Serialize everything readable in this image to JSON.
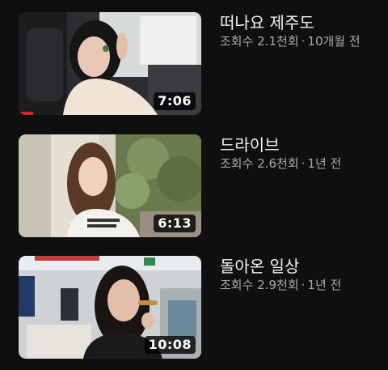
{
  "colors": {
    "background": "#0f0f0f",
    "title_text": "#f1f1f1",
    "secondary_text": "#aaaaaa",
    "progress_red": "#e8201c",
    "duration_badge_bg": "#000000cc"
  },
  "videos": [
    {
      "title": "떠나요 제주도",
      "views": "조회수 2.1천회",
      "separator": "·",
      "age": "10개월 전",
      "duration": "7:06",
      "watched_fraction": 0.08
    },
    {
      "title": "드라이브",
      "views": "조회수 2.6천회",
      "separator": "·",
      "age": "1년 전",
      "duration": "6:13",
      "watched_fraction": 0
    },
    {
      "title": "돌아온 일상",
      "views": "조회수 2.9천회",
      "separator": "·",
      "age": "1년 전",
      "duration": "10:08",
      "watched_fraction": 0
    }
  ]
}
